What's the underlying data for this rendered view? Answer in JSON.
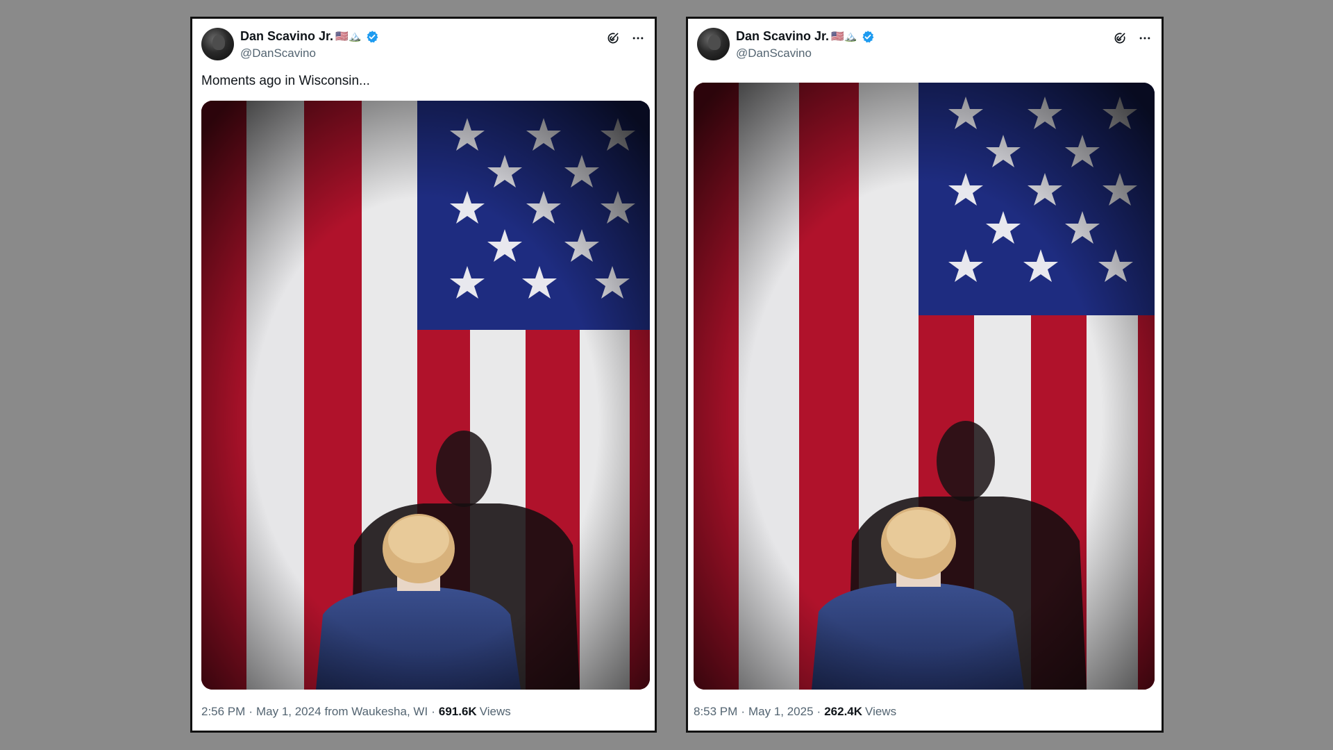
{
  "colors": {
    "background": "#8a8a8a",
    "card_border": "#111111",
    "verified": "#1d9bf0",
    "text_primary": "#0f1419",
    "text_secondary": "#536471",
    "flag_red": "#b0122b",
    "flag_white": "#e9e9ea",
    "flag_blue": "#1e2c80",
    "suit_blue": "#2d3f78"
  },
  "posts": [
    {
      "author_name": "Dan Scavino Jr.",
      "author_emoji": "🇺🇸🏔️",
      "handle": "@DanScavino",
      "text": "Moments ago in Wisconsin...",
      "time": "2:56 PM",
      "date": "May 1, 2024",
      "location": "from Waukesha, WI",
      "views_count": "691.6K",
      "views_label": "Views",
      "media_icon": "flag-photo",
      "action_icons": [
        "grok-icon",
        "more-icon"
      ]
    },
    {
      "author_name": "Dan Scavino Jr.",
      "author_emoji": "🇺🇸🏔️",
      "handle": "@DanScavino",
      "time": "8:53 PM",
      "date": "May 1, 2025",
      "views_count": "262.4K",
      "views_label": "Views",
      "media_icon": "flag-photo",
      "action_icons": [
        "grok-icon",
        "more-icon"
      ]
    }
  ]
}
